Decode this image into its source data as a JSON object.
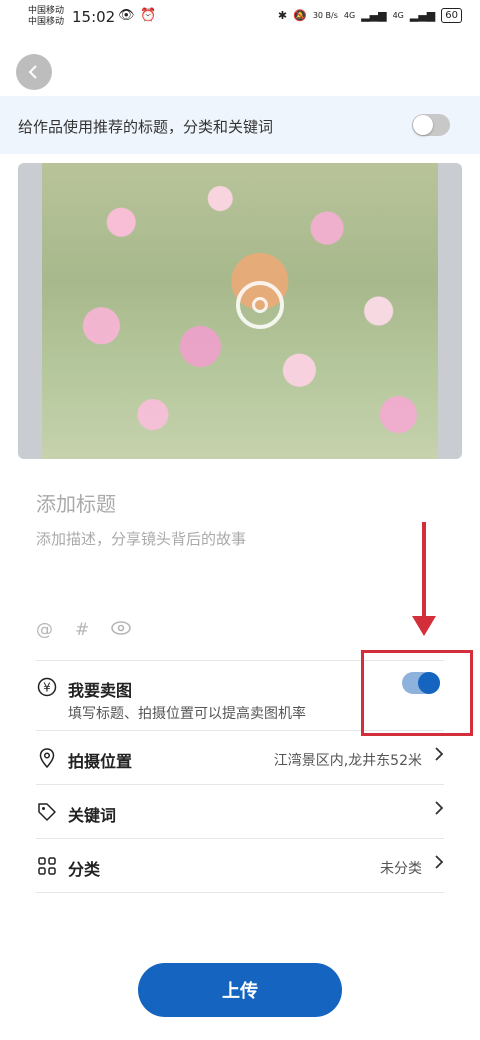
{
  "status_bar": {
    "carrier_1": "中国移动",
    "carrier_2": "中国移动",
    "time": "15:02",
    "net_speed": "30 B/s",
    "signal_1": "4G",
    "signal_2": "4G",
    "battery": "60"
  },
  "banner": {
    "text": "给作品使用推荐的标题，分类和关键词",
    "toggle_on": false
  },
  "post": {
    "title_placeholder": "添加标题",
    "desc_placeholder": "添加描述，分享镜头背后的故事",
    "mention_icon": "@",
    "hashtag_icon": "#"
  },
  "sell": {
    "label": "我要卖图",
    "subtitle": "填写标题、拍摄位置可以提高卖图机率",
    "toggle_on": true,
    "icon": "¥"
  },
  "location": {
    "label": "拍摄位置",
    "value": "江湾景区内,龙井东52米"
  },
  "keywords": {
    "label": "关键词"
  },
  "category": {
    "label": "分类",
    "value": "未分类"
  },
  "upload_button": "上传",
  "colors": {
    "accent": "#1565c0",
    "annotation": "#d32f3a",
    "banner_bg": "#eef5fc"
  }
}
